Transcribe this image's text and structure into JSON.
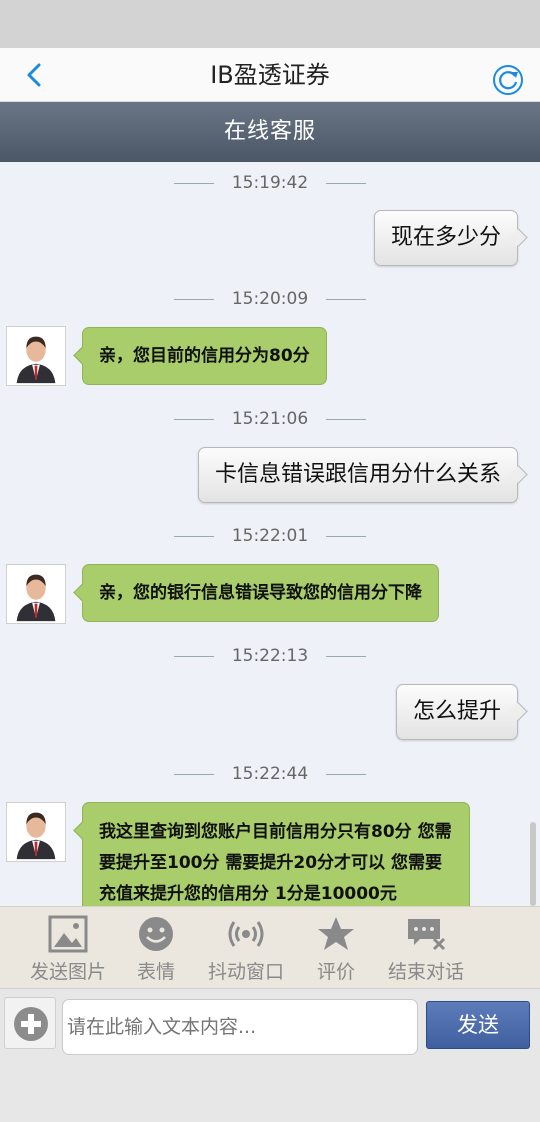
{
  "nav": {
    "title": "IB盈透证券",
    "back_icon": "chevron-left-icon",
    "refresh_icon": "refresh-icon",
    "accent": "#1a8be0"
  },
  "service_bar": {
    "title": "在线客服"
  },
  "messages": [
    {
      "time": "15:19:42",
      "from": "user",
      "text": "现在多少分"
    },
    {
      "time": "15:20:09",
      "from": "agent",
      "text": "亲，您目前的信用分为80分"
    },
    {
      "time": "15:21:06",
      "from": "user",
      "text": "卡信息错误跟信用分什么关系"
    },
    {
      "time": "15:22:01",
      "from": "agent",
      "text": "亲，您的银行信息错误导致您的信用分下降"
    },
    {
      "time": "15:22:13",
      "from": "user",
      "text": "怎么提升"
    },
    {
      "time": "15:22:44",
      "from": "agent",
      "text": "我这里查询到您账户目前信用分只有80分  您需要提升至100分 需要提升20分才可以  您需要充值来提升您的信用分 1分是10000元"
    }
  ],
  "toolbar": [
    {
      "label": "发送图片",
      "icon": "image-icon"
    },
    {
      "label": "表情",
      "icon": "smiley-icon"
    },
    {
      "label": "抖动窗口",
      "icon": "vibrate-icon"
    },
    {
      "label": "评价",
      "icon": "star-icon"
    },
    {
      "label": "结束对话",
      "icon": "end-chat-icon"
    }
  ],
  "input": {
    "placeholder": "请在此输入文本内容...",
    "value": ""
  },
  "send_label": "发送",
  "colors": {
    "agent_bubble": "#a8cd6a",
    "service_bar": "#5a6576",
    "send_button": "#4b6aab"
  }
}
